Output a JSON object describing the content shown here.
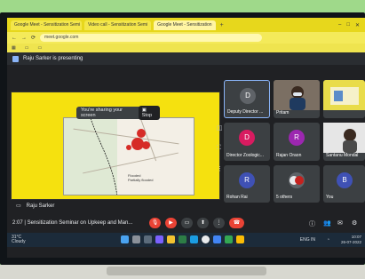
{
  "browser": {
    "tabs": [
      "Google Meet - Sensitization Semi",
      "Video call - Sensitization Semi",
      "Google Meet - Sensitization"
    ],
    "url": "meet.google.com",
    "win_controls": [
      "–",
      "□",
      "✕"
    ]
  },
  "meet": {
    "presenting_text": "Raju Sarker is presenting",
    "sharing_notice": "You're sharing your screen",
    "stop_label": "Stop",
    "presenter_name": "Raju Sarker",
    "time_title": "2:07  |  Sensitization Seminar on Upkeep and Man...",
    "map_legend": [
      "Flooded",
      "Partially flooded"
    ]
  },
  "participants": [
    {
      "name": "Deputy Director ...",
      "initial": "D",
      "color": "#5f6368",
      "active": true
    },
    {
      "name": "Pritam",
      "initial": "",
      "color": "#7b6f63"
    },
    {
      "name": "",
      "initial": "",
      "color": "#c5b56b"
    },
    {
      "name": "Director Zoologic...",
      "initial": "D",
      "color": "#d81b60"
    },
    {
      "name": "Rajan Oraon",
      "initial": "R",
      "color": "#9c27b0"
    },
    {
      "name": "Santanu Mondal",
      "initial": "",
      "color": "#6d6d6d"
    },
    {
      "name": "Rohan Rai",
      "initial": "R",
      "color": "#3f51b5"
    },
    {
      "name": "5 others",
      "initial": "",
      "color": "#5f6368"
    },
    {
      "name": "You",
      "initial": "B",
      "color": "#3f51b5"
    }
  ],
  "taskbar": {
    "weather_temp": "31°C",
    "weather_text": "Cloudy",
    "time": "10:07",
    "date": "26-07-2022",
    "lang": "ENG IN"
  },
  "colors": {
    "tab_yellow": "#e7d71c",
    "meet_bg": "#202124",
    "end_call": "#ea4335",
    "accent": "#8ab4f8"
  }
}
